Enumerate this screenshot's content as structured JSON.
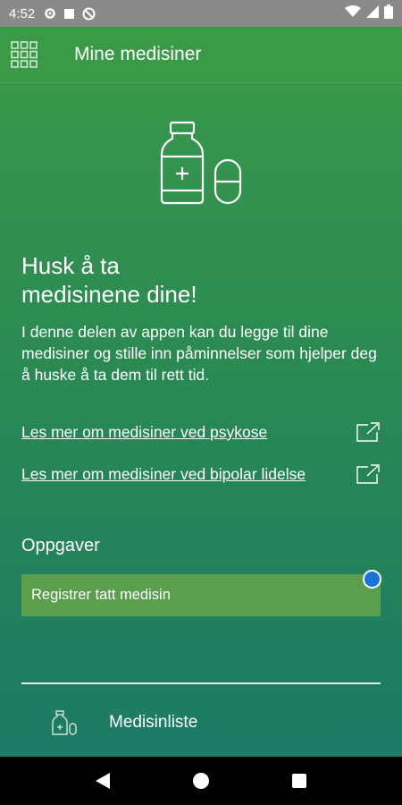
{
  "status_bar": {
    "time": "4:52"
  },
  "app_bar": {
    "title": "Mine medisiner"
  },
  "content": {
    "headline_line1": "Husk å ta",
    "headline_line2": "medisinene dine!",
    "intro": "I denne delen av appen kan du legge til dine medisiner og stille inn påminnelser som hjelper deg å huske å ta dem til rett tid.",
    "links": [
      {
        "label": "Les mer om medisiner ved psykose",
        "icon": "external-link-icon"
      },
      {
        "label": "Les mer om medisiner ved bipolar lidelse",
        "icon": "external-link-icon"
      }
    ]
  },
  "tasks": {
    "title": "Oppgaver",
    "items": [
      {
        "label": "Registrer tatt medisin"
      }
    ]
  },
  "list": {
    "items": [
      {
        "label": "Medisinliste",
        "icon": "medicine-list-icon"
      }
    ]
  },
  "colors": {
    "app_bar": "#3a9a48",
    "gradient_top": "#3a9a4a",
    "gradient_bottom": "#1c7a66",
    "task_card": "#5a9e4e",
    "badge": "#1a73d9"
  }
}
